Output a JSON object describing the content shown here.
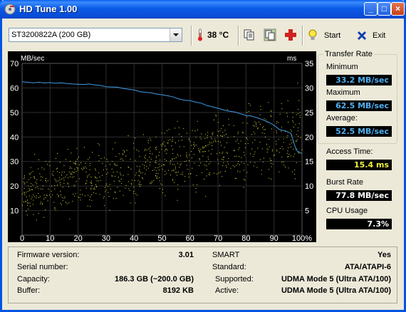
{
  "window": {
    "title": "HD Tune 1.00"
  },
  "toolbar": {
    "drive": "ST3200822A (200 GB)",
    "temperature": "38 °C",
    "start_label": "Start",
    "exit_label": "Exit"
  },
  "chart": {
    "left_unit": "MB/sec",
    "right_unit": "ms",
    "left_ticks": [
      "70",
      "60",
      "50",
      "40",
      "30",
      "20",
      "10"
    ],
    "right_ticks": [
      "35",
      "30",
      "25",
      "20",
      "15",
      "10",
      "5"
    ],
    "x_ticks": [
      "0",
      "10",
      "20",
      "30",
      "40",
      "50",
      "60",
      "70",
      "80",
      "90",
      "100%"
    ]
  },
  "chart_data": {
    "type": "line",
    "x": [
      0,
      2,
      4,
      6,
      8,
      10,
      12,
      14,
      16,
      18,
      20,
      22,
      24,
      26,
      28,
      30,
      32,
      34,
      36,
      38,
      40,
      42,
      44,
      46,
      48,
      50,
      52,
      54,
      56,
      58,
      60,
      62,
      64,
      66,
      68,
      70,
      72,
      74,
      76,
      78,
      80,
      82,
      84,
      86,
      88,
      90,
      92,
      94,
      96,
      98,
      100
    ],
    "series": [
      {
        "type": "line",
        "color": "#3E9CE8",
        "values": [
          62.5,
          62.3,
          62.1,
          62.3,
          62.0,
          62.2,
          61.9,
          62.1,
          61.8,
          61.6,
          61.5,
          61.4,
          61.6,
          61.2,
          61.0,
          60.5,
          60.4,
          60.3,
          59.8,
          59.5,
          59.2,
          58.5,
          58.2,
          58.0,
          57.5,
          57.2,
          56.8,
          56.3,
          55.5,
          55.0,
          54.8,
          54.2,
          53.8,
          52.8,
          52.3,
          51.7,
          51.0,
          50.5,
          50.2,
          49.5,
          48.8,
          48.5,
          47.8,
          47.0,
          46.0,
          44.8,
          43.0,
          42.5,
          41.5,
          34.5,
          33.2
        ]
      },
      {
        "type": "scatter",
        "color": "#E8E840",
        "y_axis": "access_time_ms",
        "values": []
      }
    ],
    "xlim": [
      0,
      100
    ],
    "ylim_left": [
      0,
      70
    ],
    "ylim_right": [
      0,
      35
    ],
    "xlabel": "",
    "ylabel_left": "MB/sec",
    "ylabel_right": "ms",
    "grid": true
  },
  "stats": {
    "transfer_rate_title": "Transfer Rate",
    "minimum_label": "Minimum",
    "minimum": "33.2 MB/sec",
    "maximum_label": "Maximum",
    "maximum": "62.5 MB/sec",
    "average_label": "Average:",
    "average": "52.5 MB/sec",
    "access_label": "Access Time:",
    "access": "15.4 ms",
    "burst_label": "Burst Rate",
    "burst": "77.8 MB/sec",
    "cpu_label": "CPU Usage",
    "cpu": "7.3%"
  },
  "info": {
    "firmware_label": "Firmware version:",
    "firmware": "3.01",
    "serial_label": "Serial number:",
    "serial": "",
    "capacity_label": "Capacity:",
    "capacity": "186.3 GB (~200.0 GB)",
    "buffer_label": "Buffer:",
    "buffer": "8192 KB",
    "smart_label": "SMART",
    "smart": "Yes",
    "standard_label": "Standard:",
    "standard": "ATA/ATAPI-6",
    "supported_label": "Supported:",
    "supported": "UDMA Mode 5 (Ultra ATA/100)",
    "active_label": "Active:",
    "active": "UDMA Mode 5 (Ultra ATA/100)"
  },
  "colors": {
    "transfer_line": "#3E9CE8",
    "access_points": "#E8E840",
    "stat_value_blue": "#4FB0F0",
    "stat_value_yellow": "#F0F040",
    "stat_value_white": "#FFFFFF"
  }
}
